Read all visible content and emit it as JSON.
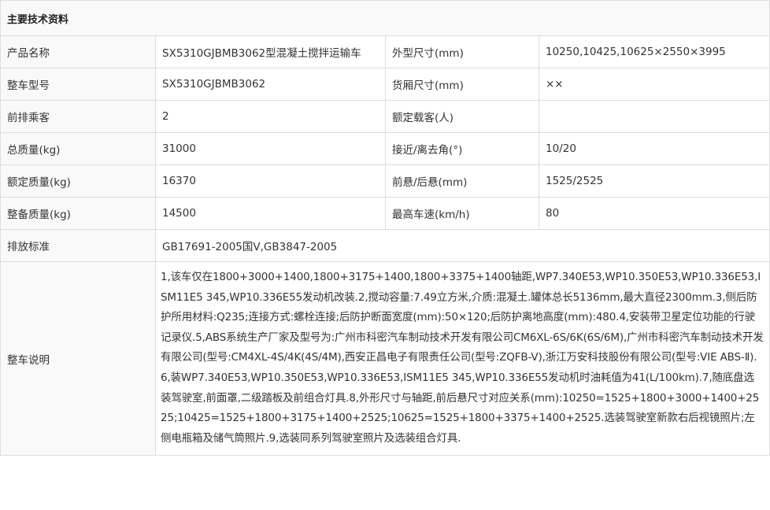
{
  "title": "主要技术资料",
  "rows": [
    {
      "label1": "产品名称",
      "value1": "SX5310GJBMB3062型混凝土搅拌运输车",
      "label2": "外型尺寸(mm)",
      "value2": "10250,10425,10625×2550×3995"
    },
    {
      "label1": "整车型号",
      "value1": "SX5310GJBMB3062",
      "label2": "货厢尺寸(mm)",
      "value2": "××"
    },
    {
      "label1": "前排乘客",
      "value1": "2",
      "label2": "额定载客(人)",
      "value2": ""
    },
    {
      "label1": "总质量(kg)",
      "value1": "31000",
      "label2": "接近/离去角(°)",
      "value2": "10/20"
    },
    {
      "label1": "额定质量(kg)",
      "value1": "16370",
      "label2": "前悬/后悬(mm)",
      "value2": "1525/2525"
    },
    {
      "label1": "整备质量(kg)",
      "value1": "14500",
      "label2": "最高车速(km/h)",
      "value2": "80"
    }
  ],
  "emission": {
    "label": "排放标准",
    "value": "GB17691-2005国Ⅴ,GB3847-2005"
  },
  "notes": {
    "label": "整车说明",
    "value": "1,该车仅在1800+3000+1400,1800+3175+1400,1800+3375+1400轴距,WP7.340E53,WP10.350E53,WP10.336E53,ISM11E5 345,WP10.336E55发动机改装.2,搅动容量:7.49立方米,介质:混凝土.罐体总长5136mm,最大直径2300mm.3,侧后防护所用材料:Q235;连接方式:螺栓连接;后防护断面宽度(mm):50×120;后防护离地高度(mm):480.4,安装带卫星定位功能的行驶记录仪.5,ABS系统生产厂家及型号为:广州市科密汽车制动技术开发有限公司CM6XL-6S/6K(6S/6M),广州市科密汽车制动技术开发有限公司(型号:CM4XL-4S/4K(4S/4M),西安正昌电子有限责任公司(型号:ZQFB-V),浙江万安科技股份有限公司(型号:VIE ABS-Ⅱ).6,装WP7.340E53,WP10.350E53,WP10.336E53,ISM11E5 345,WP10.336E55发动机时油耗值为41(L/100km).7,随底盘选装驾驶室,前面罩,二级踏板及前组合灯具.8,外形尺寸与轴距,前后悬尺寸对应关系(mm):10250=1525+1800+3000+1400+2525;10425=1525+1800+3175+1400+2525;10625=1525+1800+3375+1400+2525.选装驾驶室新款右后视镜照片;左侧电瓶箱及储气筒照片.9,选装同系列驾驶室照片及选装组合灯具."
  }
}
